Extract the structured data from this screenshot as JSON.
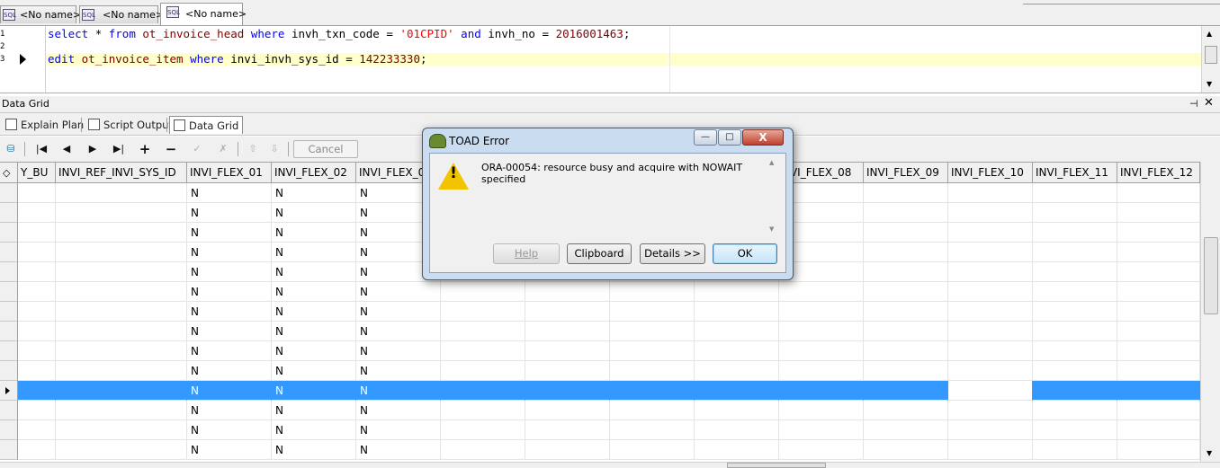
{
  "tabs": [
    {
      "label": "<No name>",
      "icon": "sql-file-icon",
      "active": false
    },
    {
      "label": "<No name>",
      "icon": "sql-file-icon",
      "active": false
    },
    {
      "label": "<No name>",
      "icon": "sql-file-icon",
      "active": true
    }
  ],
  "editor": {
    "line_numbers": [
      "1",
      "2",
      "3"
    ],
    "line1": {
      "kw1": "select",
      "star": "*",
      "kw2": "from",
      "table": "ot_invoice_head",
      "kw3": "where",
      "col1": "invh_txn_code",
      "eq1": "=",
      "str": "'01CPID'",
      "kw4": "and",
      "col2": "invh_no",
      "eq2": "=",
      "num": "2016001463",
      "end": ";"
    },
    "line3": {
      "kw1": "edit",
      "table": "ot_invoice_item",
      "kw2": "where",
      "col": "invi_invh_sys_id",
      "eq": "=",
      "num": "142233330",
      "end": ";"
    }
  },
  "panel": {
    "title": "Data Grid",
    "subtabs": [
      "Explain Plan",
      "Script Output",
      "Data Grid"
    ],
    "active_subtab": "Data Grid"
  },
  "toolbar": {
    "icons": [
      "grid-options-icon",
      "first-record-icon",
      "prior-record-icon",
      "next-record-icon",
      "last-record-icon",
      "insert-record-icon",
      "delete-record-icon",
      "post-edit-icon",
      "cancel-edit-icon",
      "upload-icon",
      "download-icon"
    ],
    "cancel_label": "Cancel"
  },
  "grid": {
    "columns": [
      "Y_BU",
      "INVI_REF_INVI_SYS_ID",
      "INVI_FLEX_01",
      "INVI_FLEX_02",
      "INVI_FLEX_0",
      "",
      "",
      "",
      "NVI_FLEX_08",
      "INVI_FLEX_09",
      "INVI_FLEX_10",
      "INVI_FLEX_11",
      "INVI_FLEX_12"
    ],
    "rows": [
      [
        "",
        "",
        "N",
        "N",
        "N"
      ],
      [
        "",
        "",
        "N",
        "N",
        "N"
      ],
      [
        "",
        "",
        "N",
        "N",
        "N"
      ],
      [
        "",
        "",
        "N",
        "N",
        "N"
      ],
      [
        "",
        "",
        "N",
        "N",
        "N"
      ],
      [
        "",
        "",
        "N",
        "N",
        "N"
      ],
      [
        "",
        "",
        "N",
        "N",
        "N"
      ],
      [
        "",
        "",
        "N",
        "N",
        "N"
      ],
      [
        "",
        "",
        "N",
        "N",
        "N"
      ],
      [
        "",
        "",
        "N",
        "N",
        "N"
      ],
      [
        "",
        "",
        "N",
        "N",
        "N"
      ],
      [
        "",
        "",
        "N",
        "N",
        "N"
      ],
      [
        "",
        "",
        "N",
        "N",
        "N"
      ],
      [
        "",
        "",
        "N",
        "N",
        "N"
      ]
    ],
    "selected_row_index": 10
  },
  "dialog": {
    "title": "TOAD Error",
    "message": "ORA-00054: resource busy and acquire with NOWAIT specified",
    "buttons": {
      "help": "Help",
      "clipboard": "Clipboard",
      "details": "Details >>",
      "ok": "OK"
    },
    "window_buttons": {
      "minimize": "—",
      "maximize": "□",
      "close": "X"
    }
  }
}
